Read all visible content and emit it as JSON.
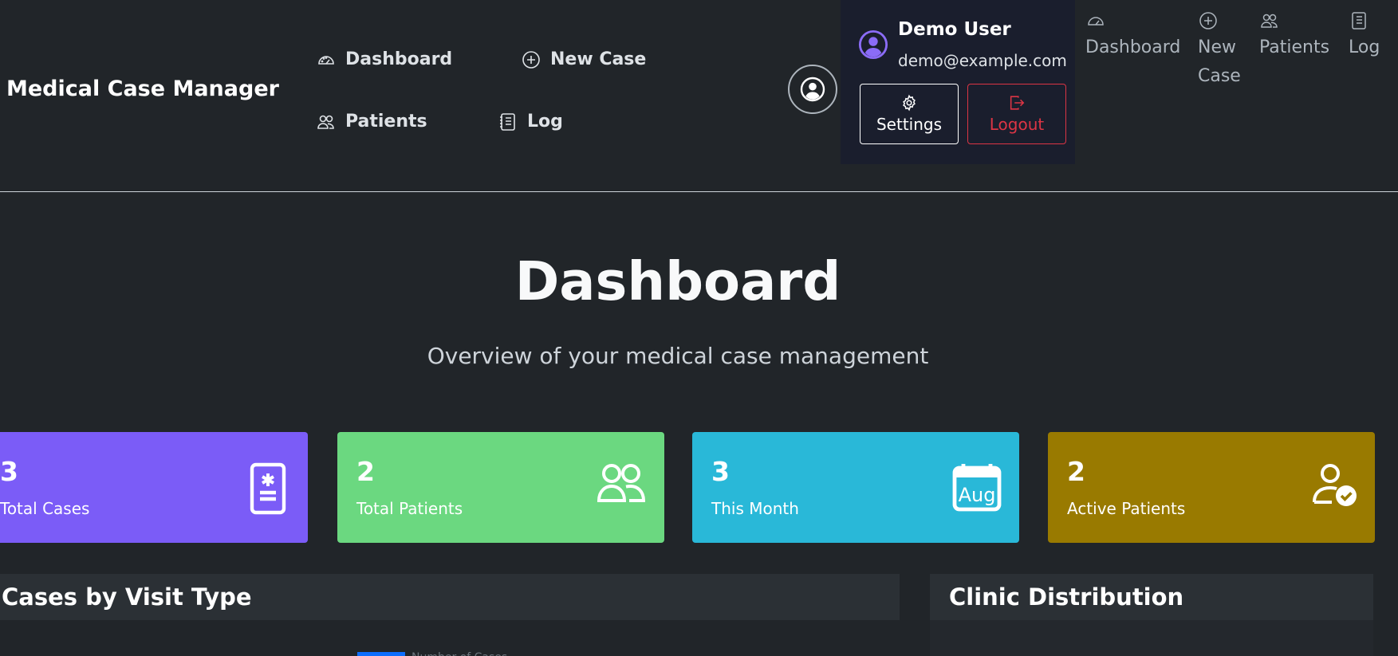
{
  "brand": "Medical Case Manager",
  "nav": {
    "dashboard": "Dashboard",
    "new_case": "New Case",
    "patients": "Patients",
    "log": "Log"
  },
  "user_menu": {
    "name": "Demo User",
    "email": "demo@example.com",
    "settings_label": "Settings",
    "logout_label": "Logout"
  },
  "collapsed_nav": {
    "dashboard": "Dashboard",
    "new_case_line1": "New",
    "new_case_line2": "Case",
    "patients": "Patients",
    "log": "Log"
  },
  "page": {
    "title": "Dashboard",
    "subtitle": "Overview of your medical case management"
  },
  "stats": [
    {
      "value": "3",
      "label": "Total Cases",
      "color": "#7b5cf7",
      "icon": "medical-card-icon"
    },
    {
      "value": "2",
      "label": "Total Patients",
      "color": "#6bd880",
      "icon": "people-icon"
    },
    {
      "value": "3",
      "label": "This Month",
      "color": "#29b8d8",
      "icon": "calendar-icon",
      "icon_text": "Aug"
    },
    {
      "value": "2",
      "label": "Active Patients",
      "color": "#997a00",
      "icon": "person-check-icon"
    }
  ],
  "panels": {
    "visit_type_title": "Cases by Visit Type",
    "clinic_title": "Clinic Distribution",
    "legend_label": "Number of Cases"
  }
}
